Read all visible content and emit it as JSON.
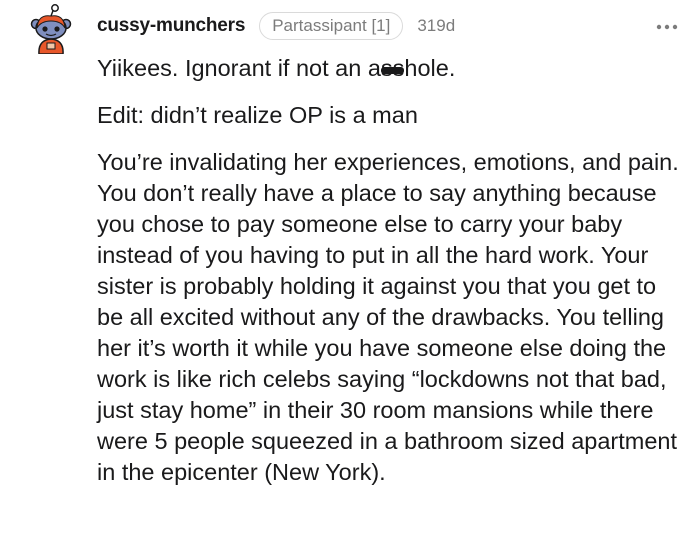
{
  "comment": {
    "username": "cussy-munchers",
    "flair": "Partassipant [1]",
    "age": "319d",
    "more_icon": "more-horizontal-icon",
    "avatar_icon": "snoo-avatar-icon",
    "paragraphs": {
      "p1_before": "Yiikees. Ignorant if not an a",
      "p1_censored": "ss",
      "p1_after": "hole.",
      "p2": "Edit: didn’t realize OP is a man",
      "p3": "You’re invalidating her experiences, emotions, and pain. You don’t really have a place to say anything because you chose to pay someone else to carry your baby instead of you having to put in all the hard work. Your sister is probably holding it against you that you get to be all excited without any of the drawbacks. You telling her it’s worth it while you have someone else doing the work is like rich celebs saying “lockdowns not that bad, just stay home” in their 30 room mansions while there were 5 people squeezed in a bathroom sized apartment in the epicenter (New York)."
    }
  },
  "colors": {
    "text": "#1a1a1b",
    "meta": "#7c7c7c",
    "avatar_body": "#7f8fbf",
    "avatar_accent": "#e8572a"
  }
}
